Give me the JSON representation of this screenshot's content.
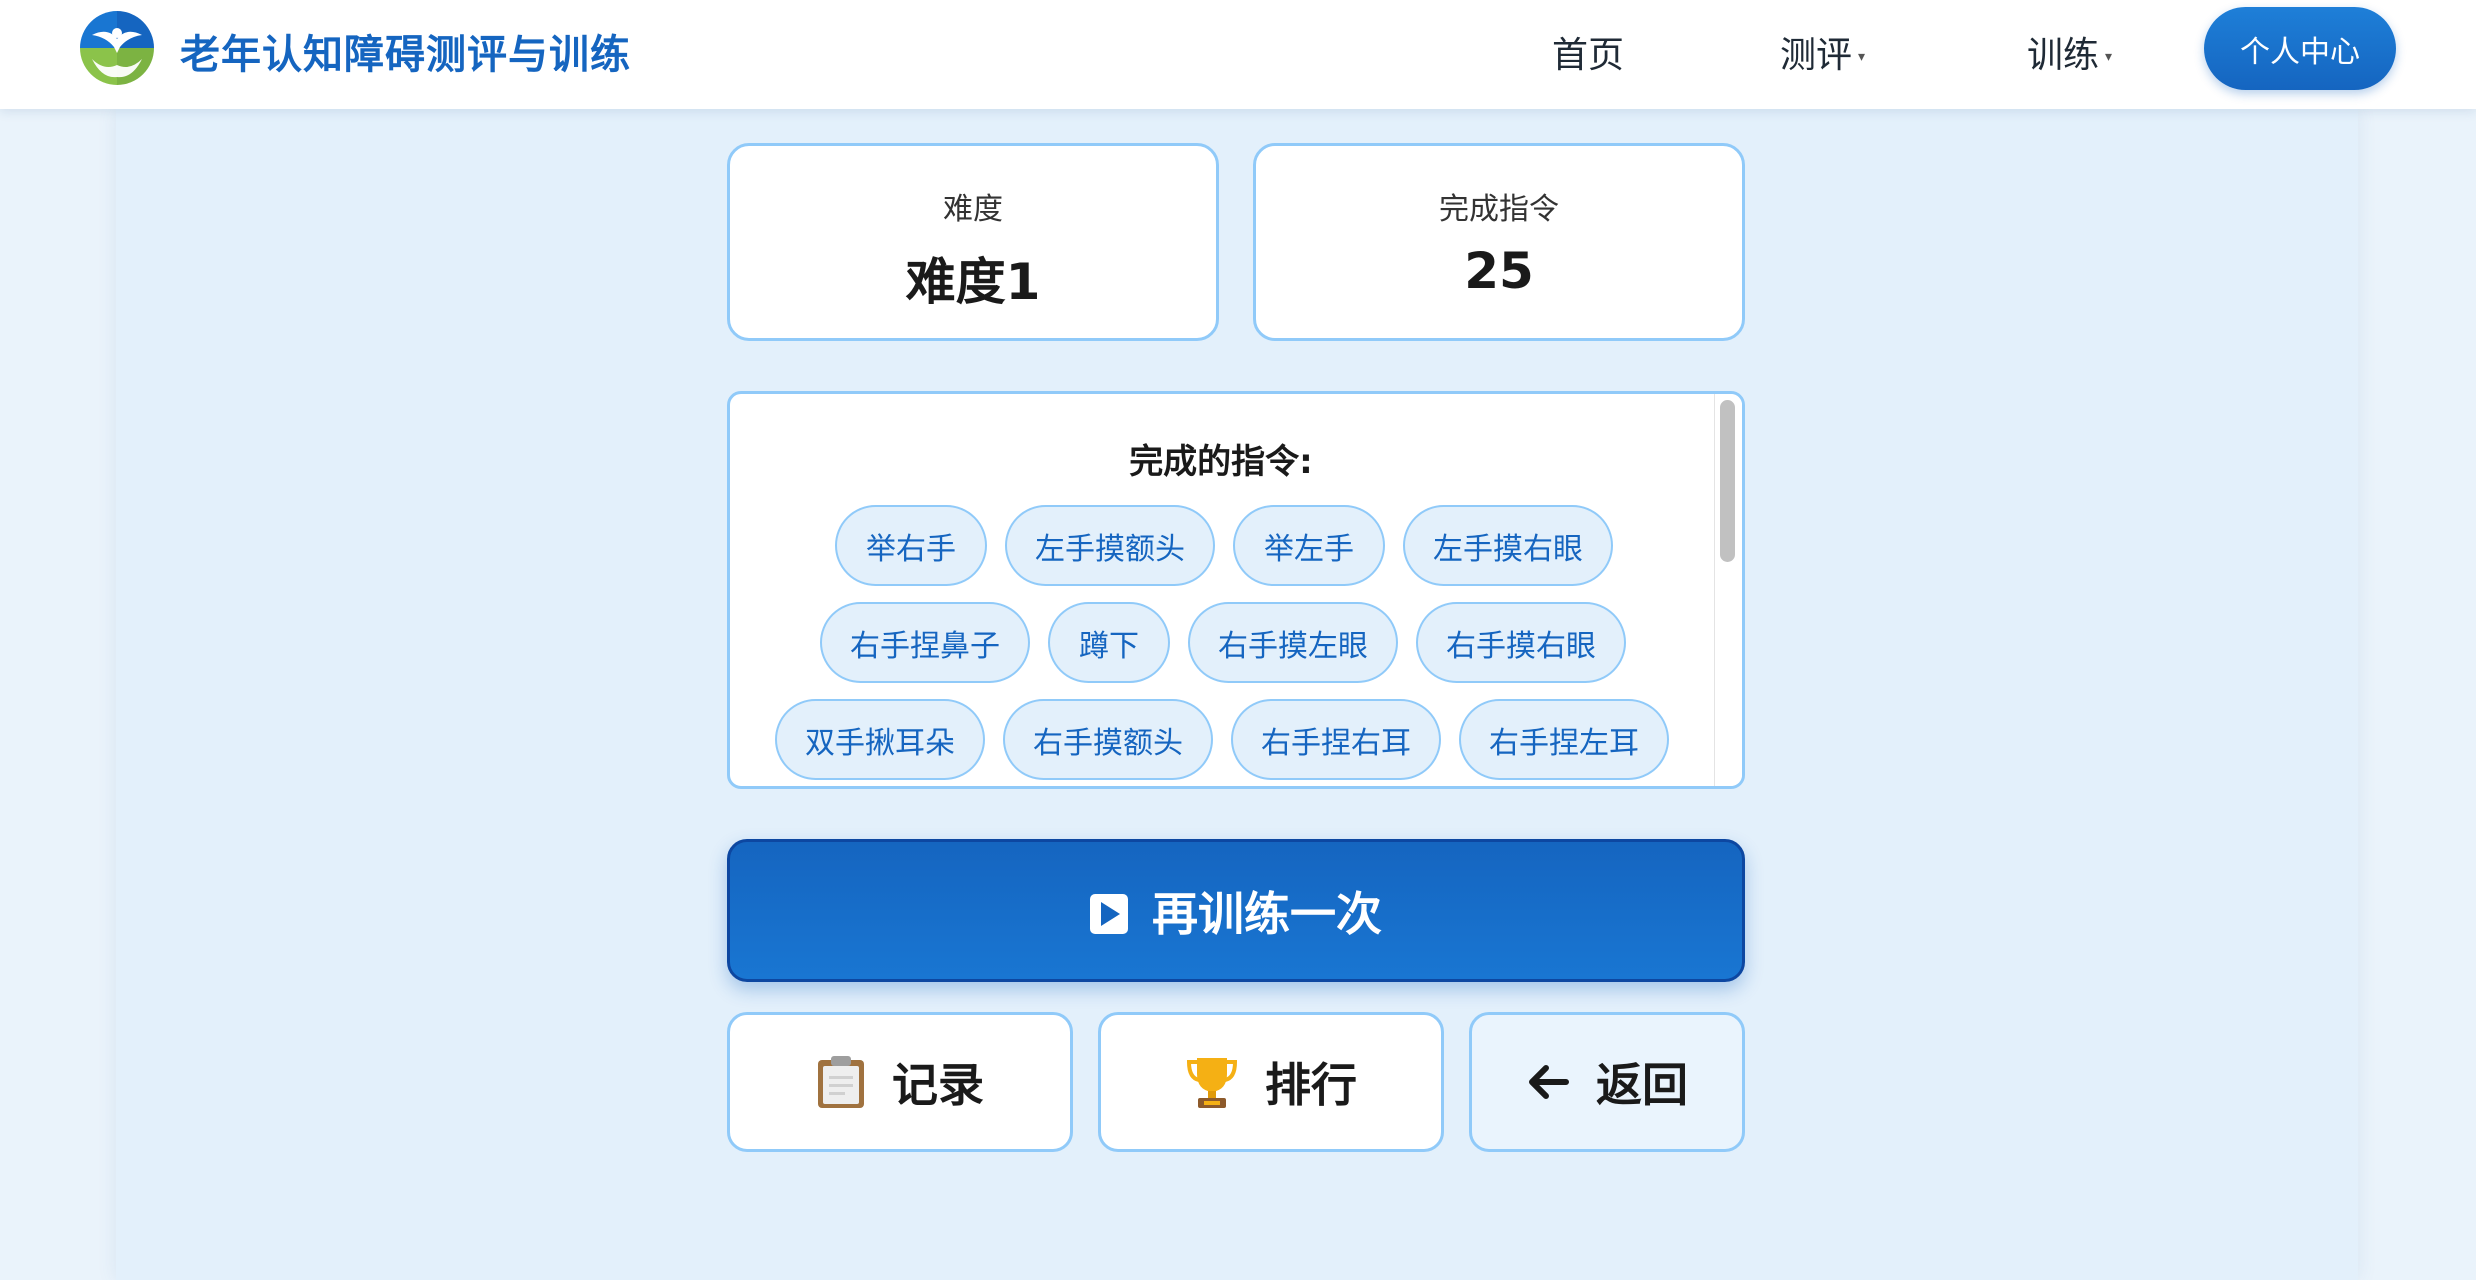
{
  "header": {
    "brand": "老年认知障碍测评与训练",
    "nav": [
      {
        "label": "首页",
        "has_caret": false
      },
      {
        "label": "测评",
        "has_caret": true
      },
      {
        "label": "训练",
        "has_caret": true
      }
    ],
    "caret_glyph": "▾",
    "personal_center": "个人中心",
    "logo_icon": "dove-hands-logo-icon"
  },
  "stats": {
    "difficulty": {
      "label": "难度",
      "value": "难度1"
    },
    "completed": {
      "label": "完成指令",
      "value": "25"
    }
  },
  "commands": {
    "title": "完成的指令:",
    "items": [
      "举右手",
      "左手摸额头",
      "举左手",
      "左手摸右眼",
      "右手捏鼻子",
      "蹲下",
      "右手摸左眼",
      "右手摸右眼",
      "双手揪耳朵",
      "右手摸额头",
      "右手捏右耳",
      "右手捏左耳"
    ]
  },
  "actions": {
    "retrain": "再训练一次",
    "records": "记录",
    "ranking": "排行",
    "back": "返回"
  },
  "colors": {
    "primary": "#1565c0",
    "border": "#90caf9",
    "tag_bg": "#e3f0fb",
    "panel_bg": "#e3f0fb"
  }
}
